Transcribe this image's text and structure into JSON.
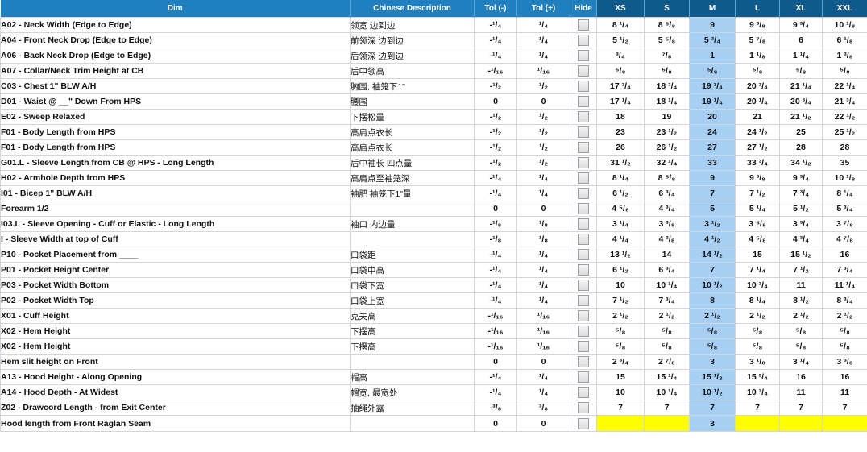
{
  "headers": {
    "dim": "Dim",
    "chinese": "Chinese Description",
    "tol_minus": "Tol (-)",
    "tol_plus": "Tol (+)",
    "hide": "Hide",
    "sizes": [
      "XS",
      "S",
      "M",
      "L",
      "XL",
      "XXL"
    ]
  },
  "colors": {
    "header_blue": "#1f7fbf",
    "header_dark": "#0e5a8c",
    "m_column": "#a7cff3",
    "highlight_yellow": "#ffff00"
  },
  "rows": [
    {
      "dim": "A02 - Neck Width (Edge to Edge)",
      "cn": "领宽 边到边",
      "tm": "-¹/₄",
      "tp": "¹/₄",
      "v": [
        "8 ¹/₄",
        "8 ⁵/₈",
        "9",
        "9 ³/₈",
        "9 ³/₄",
        "10 ¹/₈"
      ]
    },
    {
      "dim": "A04 - Front Neck Drop (Edge to Edge)",
      "cn": "前领深 边到边",
      "tm": "-¹/₄",
      "tp": "¹/₄",
      "v": [
        "5 ¹/₂",
        "5 ⁵/₈",
        "5 ³/₄",
        "5 ⁷/₈",
        "6",
        "6 ¹/₈"
      ]
    },
    {
      "dim": "A06 - Back Neck Drop (Edge to Edge)",
      "cn": "后领深 边到边",
      "tm": "-¹/₄",
      "tp": "¹/₄",
      "v": [
        "³/₄",
        "⁷/₈",
        "1",
        "1 ¹/₈",
        "1 ¹/₄",
        "1 ³/₈"
      ]
    },
    {
      "dim": "A07 - Collar/Neck Trim Height at CB",
      "cn": "后中领高",
      "tm": "-¹/₁₆",
      "tp": "¹/₁₆",
      "v": [
        "⁵/₈",
        "⁵/₈",
        "⁵/₈",
        "⁵/₈",
        "⁵/₈",
        "⁵/₈"
      ]
    },
    {
      "dim": "C03 - Chest 1\" BLW A/H",
      "cn": "胸围, 袖笼下1\"",
      "tm": "-¹/₂",
      "tp": "¹/₂",
      "v": [
        "17 ³/₄",
        "18 ³/₄",
        "19 ³/₄",
        "20 ³/₄",
        "21 ¹/₄",
        "22 ¹/₄"
      ]
    },
    {
      "dim": "D01 - Waist @ __\" Down From HPS",
      "cn": "腰围",
      "tm": "0",
      "tp": "0",
      "v": [
        "17 ¹/₄",
        "18 ¹/₄",
        "19 ¹/₄",
        "20 ¹/₄",
        "20 ³/₄",
        "21 ³/₄"
      ]
    },
    {
      "dim": "E02 - Sweep Relaxed",
      "cn": "下摆松量",
      "tm": "-¹/₂",
      "tp": "¹/₂",
      "v": [
        "18",
        "19",
        "20",
        "21",
        "21 ¹/₂",
        "22 ¹/₂"
      ]
    },
    {
      "dim": "F01 - Body Length from HPS",
      "cn": "高肩点衣长",
      "tm": "-¹/₂",
      "tp": "¹/₂",
      "v": [
        "23",
        "23 ¹/₂",
        "24",
        "24 ¹/₂",
        "25",
        "25 ¹/₂"
      ]
    },
    {
      "dim": "F01 - Body Length from HPS",
      "cn": "高肩点衣长",
      "tm": "-¹/₂",
      "tp": "¹/₂",
      "v": [
        "26",
        "26 ¹/₂",
        "27",
        "27 ¹/₂",
        "28",
        "28"
      ]
    },
    {
      "dim": "G01.L - Sleeve Length from CB @ HPS - Long Length",
      "cn": "后中袖长 四点量",
      "tm": "-¹/₂",
      "tp": "¹/₂",
      "v": [
        "31 ¹/₂",
        "32 ¹/₄",
        "33",
        "33 ³/₄",
        "34 ¹/₂",
        "35"
      ]
    },
    {
      "dim": "H02 - Armhole Depth from HPS",
      "cn": "高肩点至袖笼深",
      "tm": "-¹/₄",
      "tp": "¹/₄",
      "v": [
        "8 ¹/₄",
        "8 ⁵/₈",
        "9",
        "9 ³/₈",
        "9 ³/₄",
        "10 ¹/₈"
      ]
    },
    {
      "dim": "I01 - Bicep 1\" BLW A/H",
      "cn": "袖肥 袖笼下1\"量",
      "tm": "-¹/₄",
      "tp": "¹/₄",
      "v": [
        "6 ¹/₂",
        "6 ³/₄",
        "7",
        "7 ¹/₂",
        "7 ³/₄",
        "8 ¹/₄"
      ]
    },
    {
      "dim": "Forearm 1/2",
      "cn": "",
      "tm": "0",
      "tp": "0",
      "v": [
        "4 ⁵/₈",
        "4 ³/₄",
        "5",
        "5 ¹/₄",
        "5 ¹/₂",
        "5 ³/₄"
      ]
    },
    {
      "dim": "I03.L - Sleeve Opening - Cuff or Elastic - Long Length",
      "cn": "袖口 内边量",
      "tm": "-¹/₈",
      "tp": "¹/₈",
      "v": [
        "3 ¹/₄",
        "3 ³/₈",
        "3 ¹/₂",
        "3 ⁵/₈",
        "3 ³/₄",
        "3 ⁷/₈"
      ]
    },
    {
      "dim": "I - Sleeve Width at top of Cuff",
      "cn": "",
      "tm": "-¹/₈",
      "tp": "¹/₈",
      "v": [
        "4 ¹/₄",
        "4 ³/₈",
        "4 ¹/₂",
        "4 ⁵/₈",
        "4 ³/₄",
        "4 ⁷/₈"
      ]
    },
    {
      "dim": "P10 - Pocket Placement from ____",
      "cn": "口袋距",
      "tm": "-¹/₄",
      "tp": "¹/₄",
      "v": [
        "13 ¹/₂",
        "14",
        "14 ¹/₂",
        "15",
        "15 ¹/₂",
        "16"
      ]
    },
    {
      "dim": "P01 - Pocket Height Center",
      "cn": "口袋中高",
      "tm": "-¹/₄",
      "tp": "¹/₄",
      "v": [
        "6 ¹/₂",
        "6 ³/₄",
        "7",
        "7 ¹/₄",
        "7 ¹/₂",
        "7 ³/₄"
      ]
    },
    {
      "dim": "P03 - Pocket Width Bottom",
      "cn": "口袋下宽",
      "tm": "-¹/₄",
      "tp": "¹/₄",
      "v": [
        "10",
        "10 ¹/₄",
        "10 ¹/₂",
        "10 ³/₄",
        "11",
        "11 ¹/₄"
      ]
    },
    {
      "dim": "P02 - Pocket Width Top",
      "cn": "口袋上宽",
      "tm": "-¹/₄",
      "tp": "¹/₄",
      "v": [
        "7 ¹/₂",
        "7 ³/₄",
        "8",
        "8 ¹/₄",
        "8 ¹/₂",
        "8 ³/₄"
      ]
    },
    {
      "dim": "X01 - Cuff Height",
      "cn": "克夫高",
      "tm": "-¹/₁₆",
      "tp": "¹/₁₆",
      "v": [
        "2 ¹/₂",
        "2 ¹/₂",
        "2 ¹/₂",
        "2 ¹/₂",
        "2 ¹/₂",
        "2 ¹/₂"
      ]
    },
    {
      "dim": "X02 - Hem Height",
      "cn": "下摆高",
      "tm": "-¹/₁₆",
      "tp": "¹/₁₆",
      "v": [
        "⁵/₈",
        "⁵/₈",
        "⁵/₈",
        "⁵/₈",
        "⁵/₈",
        "⁵/₈"
      ]
    },
    {
      "dim": "X02 - Hem Height",
      "cn": "下摆高",
      "tm": "-¹/₁₆",
      "tp": "¹/₁₆",
      "v": [
        "⁵/₈",
        "⁵/₈",
        "⁵/₈",
        "⁵/₈",
        "⁵/₈",
        "⁵/₈"
      ]
    },
    {
      "dim": "Hem slit height on Front",
      "cn": "",
      "tm": "0",
      "tp": "0",
      "v": [
        "2 ³/₄",
        "2 ⁷/₈",
        "3",
        "3 ¹/₈",
        "3 ¹/₄",
        "3 ³/₈"
      ]
    },
    {
      "dim": "A13 - Hood Height - Along Opening",
      "cn": "帽高",
      "tm": "-¹/₄",
      "tp": "¹/₄",
      "v": [
        "15",
        "15 ¹/₄",
        "15 ¹/₂",
        "15 ³/₄",
        "16",
        "16"
      ]
    },
    {
      "dim": "A14 - Hood Depth - At Widest",
      "cn": "帽宽, 最宽处",
      "tm": "-¹/₄",
      "tp": "¹/₄",
      "v": [
        "10",
        "10 ¹/₄",
        "10 ¹/₂",
        "10 ³/₄",
        "11",
        "11"
      ]
    },
    {
      "dim": "Z02 - Drawcord Length - from Exit Center",
      "cn": "抽绳外露",
      "tm": "-³/₈",
      "tp": "³/₈",
      "v": [
        "7",
        "7",
        "7",
        "7",
        "7",
        "7"
      ]
    },
    {
      "dim": "Hood length from Front Raglan Seam",
      "cn": "",
      "tm": "0",
      "tp": "0",
      "v": [
        "",
        "",
        "3",
        "",
        "",
        ""
      ],
      "yellow": true
    }
  ]
}
